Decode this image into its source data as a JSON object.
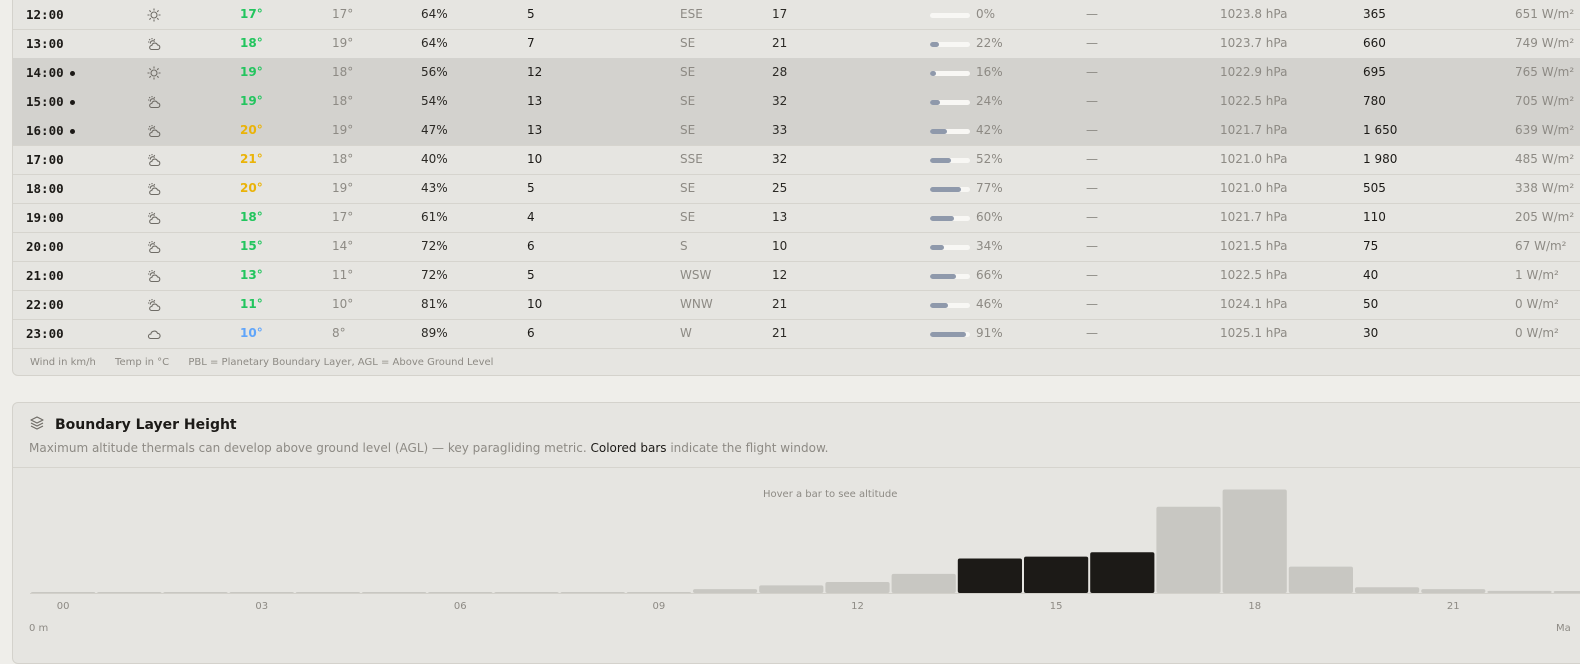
{
  "hourly_table": {
    "rows": [
      {
        "time": "12:00",
        "icon": "sun-icon",
        "temp": "17°",
        "temp_color": "#22c55e",
        "feels": "17°",
        "humidity": "64%",
        "wind": "5",
        "dir": "ESE",
        "gust": "17",
        "cloud_pct": 0,
        "cloud": "0%",
        "precip": "—",
        "pressure": "1023.8 hPa",
        "pbl": "365",
        "radiation": "651 W/m²",
        "highlight": false,
        "marked": false
      },
      {
        "time": "13:00",
        "icon": "partly-cloudy-icon",
        "temp": "18°",
        "temp_color": "#22c55e",
        "feels": "19°",
        "humidity": "64%",
        "wind": "7",
        "dir": "SE",
        "gust": "21",
        "cloud_pct": 22,
        "cloud": "22%",
        "precip": "—",
        "pressure": "1023.7 hPa",
        "pbl": "660",
        "radiation": "749 W/m²",
        "highlight": false,
        "marked": false
      },
      {
        "time": "14:00",
        "icon": "sun-icon",
        "temp": "19°",
        "temp_color": "#22c55e",
        "feels": "18°",
        "humidity": "56%",
        "wind": "12",
        "dir": "SE",
        "gust": "28",
        "cloud_pct": 16,
        "cloud": "16%",
        "precip": "—",
        "pressure": "1022.9 hPa",
        "pbl": "695",
        "radiation": "765 W/m²",
        "highlight": true,
        "marked": true
      },
      {
        "time": "15:00",
        "icon": "partly-cloudy-icon",
        "temp": "19°",
        "temp_color": "#22c55e",
        "feels": "18°",
        "humidity": "54%",
        "wind": "13",
        "dir": "SE",
        "gust": "32",
        "cloud_pct": 24,
        "cloud": "24%",
        "precip": "—",
        "pressure": "1022.5 hPa",
        "pbl": "780",
        "radiation": "705 W/m²",
        "highlight": true,
        "marked": true
      },
      {
        "time": "16:00",
        "icon": "partly-cloudy-icon",
        "temp": "20°",
        "temp_color": "#eab308",
        "feels": "19°",
        "humidity": "47%",
        "wind": "13",
        "dir": "SE",
        "gust": "33",
        "cloud_pct": 42,
        "cloud": "42%",
        "precip": "—",
        "pressure": "1021.7 hPa",
        "pbl": "1 650",
        "radiation": "639 W/m²",
        "highlight": true,
        "marked": true
      },
      {
        "time": "17:00",
        "icon": "partly-cloudy-icon",
        "temp": "21°",
        "temp_color": "#eab308",
        "feels": "18°",
        "humidity": "40%",
        "wind": "10",
        "dir": "SSE",
        "gust": "32",
        "cloud_pct": 52,
        "cloud": "52%",
        "precip": "—",
        "pressure": "1021.0 hPa",
        "pbl": "1 980",
        "radiation": "485 W/m²",
        "highlight": false,
        "marked": false
      },
      {
        "time": "18:00",
        "icon": "partly-cloudy-icon",
        "temp": "20°",
        "temp_color": "#eab308",
        "feels": "19°",
        "humidity": "43%",
        "wind": "5",
        "dir": "SE",
        "gust": "25",
        "cloud_pct": 77,
        "cloud": "77%",
        "precip": "—",
        "pressure": "1021.0 hPa",
        "pbl": "505",
        "radiation": "338 W/m²",
        "highlight": false,
        "marked": false
      },
      {
        "time": "19:00",
        "icon": "partly-cloudy-icon",
        "temp": "18°",
        "temp_color": "#22c55e",
        "feels": "17°",
        "humidity": "61%",
        "wind": "4",
        "dir": "SE",
        "gust": "13",
        "cloud_pct": 60,
        "cloud": "60%",
        "precip": "—",
        "pressure": "1021.7 hPa",
        "pbl": "110",
        "radiation": "205 W/m²",
        "highlight": false,
        "marked": false
      },
      {
        "time": "20:00",
        "icon": "partly-cloudy-icon",
        "temp": "15°",
        "temp_color": "#22c55e",
        "feels": "14°",
        "humidity": "72%",
        "wind": "6",
        "dir": "S",
        "gust": "10",
        "cloud_pct": 34,
        "cloud": "34%",
        "precip": "—",
        "pressure": "1021.5 hPa",
        "pbl": "75",
        "radiation": "67 W/m²",
        "highlight": false,
        "marked": false
      },
      {
        "time": "21:00",
        "icon": "partly-cloudy-icon",
        "temp": "13°",
        "temp_color": "#22c55e",
        "feels": "11°",
        "humidity": "72%",
        "wind": "5",
        "dir": "WSW",
        "gust": "12",
        "cloud_pct": 66,
        "cloud": "66%",
        "precip": "—",
        "pressure": "1022.5 hPa",
        "pbl": "40",
        "radiation": "1 W/m²",
        "highlight": false,
        "marked": false
      },
      {
        "time": "22:00",
        "icon": "partly-cloudy-icon",
        "temp": "11°",
        "temp_color": "#22c55e",
        "feels": "10°",
        "humidity": "81%",
        "wind": "10",
        "dir": "WNW",
        "gust": "21",
        "cloud_pct": 46,
        "cloud": "46%",
        "precip": "—",
        "pressure": "1024.1 hPa",
        "pbl": "50",
        "radiation": "0 W/m²",
        "highlight": false,
        "marked": false
      },
      {
        "time": "23:00",
        "icon": "cloud-icon",
        "temp": "10°",
        "temp_color": "#60a5fa",
        "feels": "8°",
        "humidity": "89%",
        "wind": "6",
        "dir": "W",
        "gust": "21",
        "cloud_pct": 91,
        "cloud": "91%",
        "precip": "—",
        "pressure": "1025.1 hPa",
        "pbl": "30",
        "radiation": "0 W/m²",
        "highlight": false,
        "marked": false
      }
    ],
    "legend": {
      "wind": "Wind in km/h",
      "temp": "Temp in °C",
      "pbl": "PBL = Planetary Boundary Layer, AGL = Above Ground Level"
    }
  },
  "pbl_section": {
    "title": "Boundary Layer Height",
    "icon": "layers-icon",
    "subtitle_pre": "Maximum altitude thermals can develop above ground level (AGL) — key paragliding metric.",
    "subtitle_bold": "Colored bars",
    "subtitle_post": "indicate the flight window.",
    "hover_hint": "Hover a bar to see altitude",
    "axis_min": "0 m",
    "axis_max": "Ma"
  },
  "chart_data": {
    "type": "bar",
    "categories": [
      "00",
      "01",
      "02",
      "03",
      "04",
      "05",
      "06",
      "07",
      "08",
      "09",
      "10",
      "11",
      "12",
      "13",
      "14",
      "15",
      "16",
      "17",
      "18",
      "19",
      "20",
      "21",
      "22",
      "23"
    ],
    "values": [
      0,
      0,
      0,
      0,
      0,
      0,
      0,
      0,
      0,
      0,
      75,
      145,
      210,
      365,
      660,
      695,
      780,
      1650,
      1980,
      505,
      110,
      75,
      40,
      30
    ],
    "colored_bars": [
      "14",
      "15",
      "16"
    ],
    "tick_labels": [
      "00",
      "03",
      "06",
      "09",
      "12",
      "15",
      "18",
      "21"
    ],
    "ylim": [
      0,
      2200
    ],
    "colors": {
      "highlight": "#1c1a17",
      "normal": "#c8c7c2"
    }
  }
}
